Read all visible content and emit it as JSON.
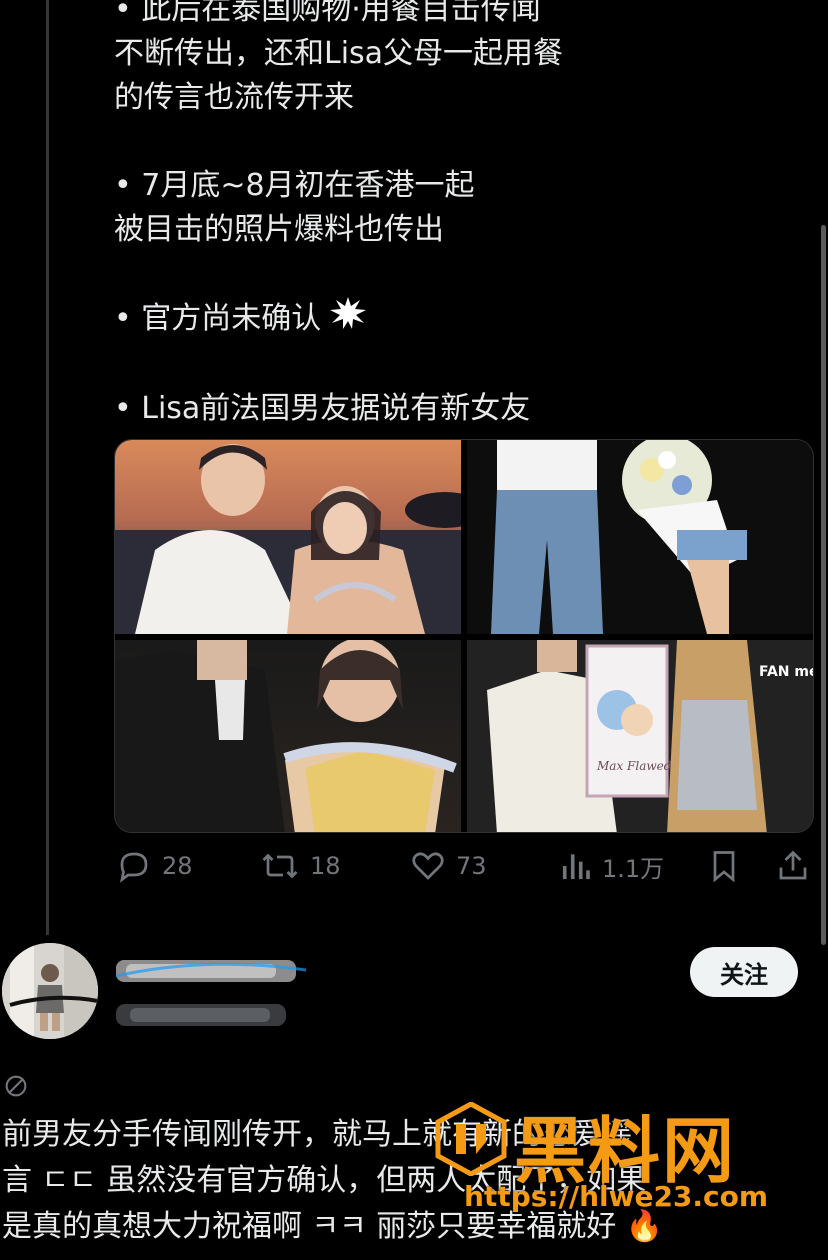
{
  "tweet": {
    "paragraphs": [
      "• 此后在泰国购物·用餐目击传闻\n不断传出，还和Lisa父母一起用餐\n的传言也流传开来",
      "• 7月底~8月初在香港一起\n被目击的照片爆料也传出",
      "• 官方尚未确认",
      "• Lisa前法国男友据说有新女友"
    ],
    "photo_captions": [
      "Max Flawed Gy",
      "FAN meetup"
    ],
    "actions": {
      "replies": "28",
      "reposts": "18",
      "likes": "73",
      "views": "1.1万"
    }
  },
  "reply": {
    "follow_label": "关注",
    "text": "前男友分手传闻刚传开，就马上就有新的恋爱谣\n言 ㄷㄷ 虽然没有官方确认，但两人太配了，如果\n是真的真想大力祝福啊 ㅋㅋ 丽莎只要幸福就好 🔥"
  },
  "watermark": {
    "title": "黑料网",
    "url": "https://hlwe23.com"
  },
  "colors": {
    "background": "#000000",
    "text": "#e7e9ea",
    "muted": "#71767b",
    "watermark": "#f59a14"
  }
}
